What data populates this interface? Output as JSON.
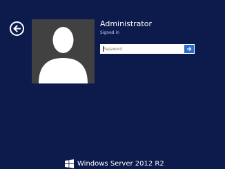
{
  "user": {
    "name": "Administrator",
    "status": "Signed in"
  },
  "password": {
    "placeholder": "Password",
    "value": ""
  },
  "icons": {
    "back": "back-arrow-icon",
    "submit": "right-arrow-icon",
    "logo": "windows-logo-icon",
    "avatar": "user-silhouette-icon"
  },
  "branding": {
    "text": "Windows Server 2012 R2"
  },
  "colors": {
    "background": "#0c1b4c",
    "avatar_bg": "#414141",
    "submit_button": "#2b6fd1"
  }
}
